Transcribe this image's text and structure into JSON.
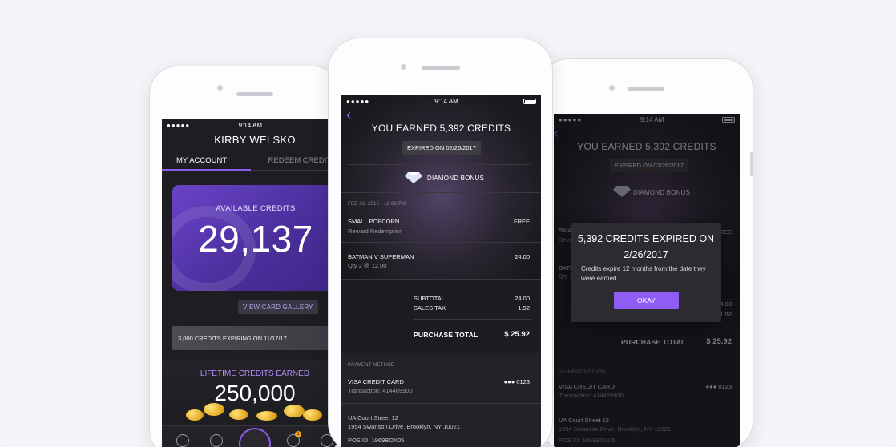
{
  "status_bar": {
    "time": "9:14 AM",
    "signal": "●●●●●"
  },
  "account_screen": {
    "user_name": "KIRBY WELSKO",
    "tabs": [
      {
        "label": "MY ACCOUNT"
      },
      {
        "label": "REDEEM CREDITS"
      }
    ],
    "available_credits_label": "AVAILABLE CREDITS",
    "available_credits_value": "29,137",
    "view_card_gallery": "VIEW CARD GALLERY",
    "expiring_notice": "3,000 CREDITS EXPIRING ON 11/17/17",
    "lifetime_label": "LIFETIME CREDITS EARNED",
    "lifetime_value": "250,000",
    "tabbar_badge": "1"
  },
  "receipt_screen": {
    "title": "YOU EARNED 5,392 CREDITS",
    "expired_on": "EXPIRED ON 02/26/2017",
    "bonus_label": "DIAMOND BONUS",
    "date_time": "FEB 26, 2016 · 12:08 PM",
    "items": [
      {
        "name": "SMALL POPCORN",
        "detail": "Reward Redemption",
        "price": "FREE"
      },
      {
        "name": "BATMAN V SUPERMAN",
        "detail": "Qty 2 @ 12.00",
        "price": "24.00"
      }
    ],
    "subtotal_label": "SUBTOTAL",
    "subtotal_value": "24.00",
    "tax_label": "SALES TAX",
    "tax_value": "1.92",
    "total_label": "PURCHASE TOTAL",
    "total_value": "$ 25.92",
    "payment_section": "PAYMENT METHOD",
    "card_name": "VISA CREDIT CARD",
    "card_last4": "●●● 0123",
    "transaction": "Transaction: 414469900",
    "venue_name": "UA Court Street 12",
    "venue_address": "1954 Swanson Drive, Brooklyn, NY 10021",
    "pos_id": "POS ID: 1969BOX05"
  },
  "expired_modal": {
    "title": "5,392 CREDITS EXPIRED ON 2/26/2017",
    "body": "Credits expire 12 months from the date they were earned.",
    "button": "OKAY"
  },
  "colors": {
    "accent": "#8f5cf5",
    "card": "#5a3bb5",
    "lifetime_label": "#b38cff"
  }
}
